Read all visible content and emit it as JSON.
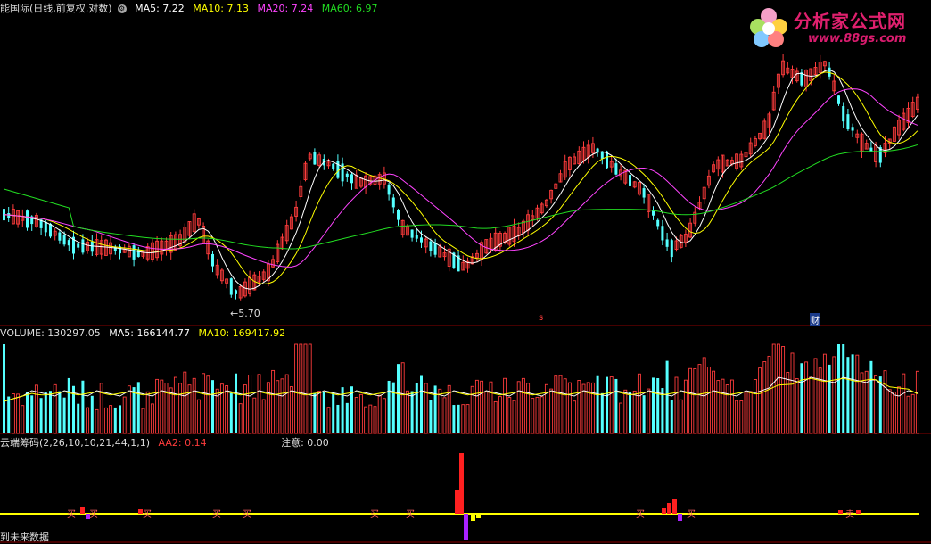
{
  "header": {
    "stock_title": "能国际(日线,前复权,对数)",
    "ma5": "MA5: 7.22",
    "ma10": "MA10: 7.13",
    "ma20": "MA20: 7.24",
    "ma60": "MA60: 6.97"
  },
  "volume_header": {
    "title": "VOLUME: 130297.05",
    "ma5": "MA5: 166144.77",
    "ma10": "MA10: 169417.92"
  },
  "indicator_header": {
    "title": "云端筹码(2,26,10,10,21,44,1,1)",
    "aa2": "AA2: 0.14",
    "note": "注意: 0.00"
  },
  "price_annotations": {
    "low_label": "←5.70",
    "marker_s": "s",
    "marker_cai": "财"
  },
  "footer": {
    "future_label": "到未来数据"
  },
  "signal_labels": [
    "买",
    "买",
    "买",
    "买",
    "买",
    "买",
    "买",
    "买",
    "买",
    "卖"
  ],
  "logo": {
    "text": "分析家公式网",
    "url": "www.88gs.com"
  },
  "colors": {
    "up": "#ff3c3c",
    "down": "#54ffff",
    "ma5": "#ffffff",
    "ma10": "#ffff00",
    "ma20": "#ff44ff",
    "ma60": "#22dd22",
    "grid": "#8b0000"
  }
}
